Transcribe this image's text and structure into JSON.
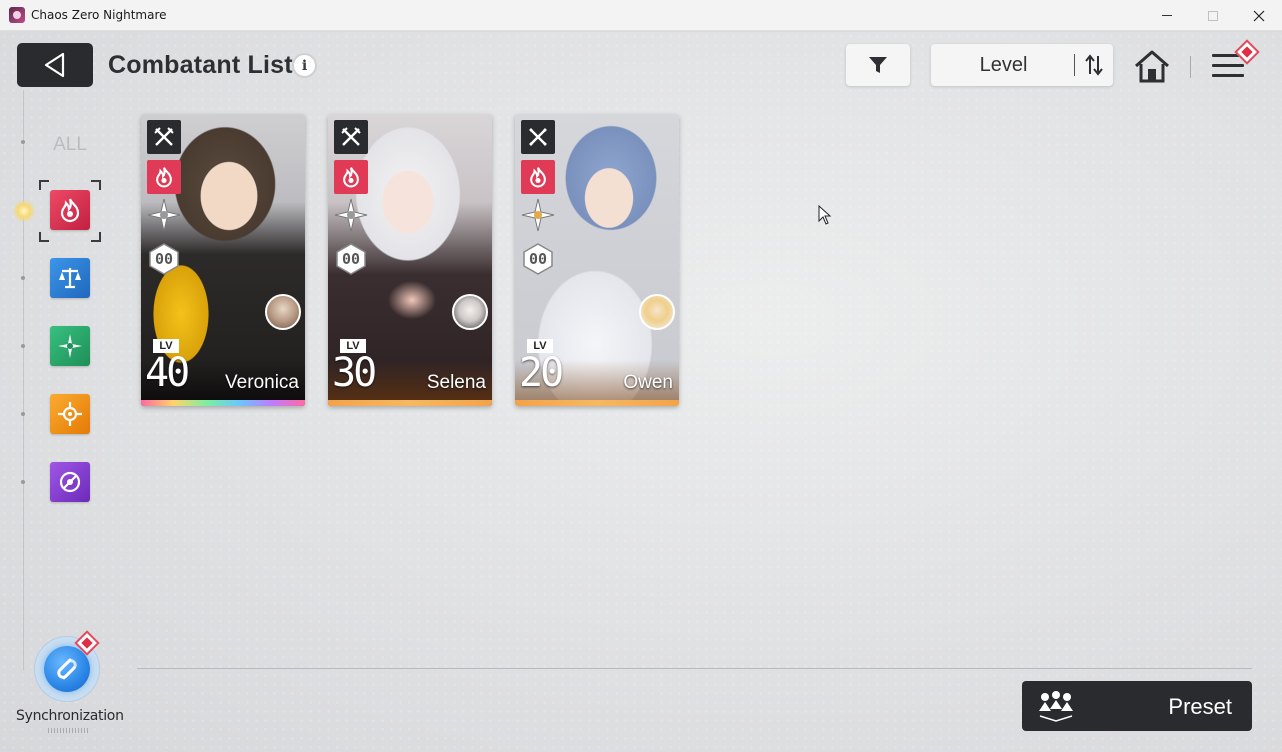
{
  "window": {
    "title": "Chaos Zero Nightmare",
    "controls": [
      "minimize",
      "maximize",
      "close"
    ]
  },
  "header": {
    "title": "Combatant List",
    "info_icon": "i",
    "sort_label": "Level",
    "icons": [
      "back-arrow-icon",
      "filter-icon",
      "sort-order-icon",
      "home-icon",
      "menu-icon"
    ]
  },
  "sidebar": {
    "all_label": "ALL",
    "categories": [
      {
        "name": "passion",
        "icon": "flame-icon",
        "color": "#d9304f",
        "selected": true
      },
      {
        "name": "order",
        "icon": "scales-icon",
        "color": "#2a7fd4",
        "selected": false
      },
      {
        "name": "justice",
        "icon": "compass-star-icon",
        "color": "#2aa86a",
        "selected": false
      },
      {
        "name": "instinct",
        "icon": "sun-crosshair-icon",
        "color": "#f08a12",
        "selected": false
      },
      {
        "name": "void",
        "icon": "void-swirl-icon",
        "color": "#8b3fd0",
        "selected": false
      }
    ],
    "sync_label": "Synchronization"
  },
  "combatants": [
    {
      "name": "Veronica",
      "lv_label": "LV",
      "level": "40",
      "slot": "00",
      "class_icon": "crossed-swords-icon",
      "element_icon": "flame-icon",
      "rarity": "rainbow"
    },
    {
      "name": "Selena",
      "lv_label": "LV",
      "level": "30",
      "slot": "00",
      "class_icon": "crossed-swords-icon",
      "element_icon": "flame-icon",
      "rarity": "orange"
    },
    {
      "name": "Owen",
      "lv_label": "LV",
      "level": "20",
      "slot": "00",
      "class_icon": "crossed-blades-icon",
      "element_icon": "flame-icon",
      "rarity": "orange"
    }
  ],
  "footer": {
    "preset_label": "Preset",
    "preset_icon": "party-members-icon"
  },
  "colors": {
    "dark_button": "#2a2b2e",
    "element_red": "#e03a56",
    "badge_red": "#e02f45"
  }
}
